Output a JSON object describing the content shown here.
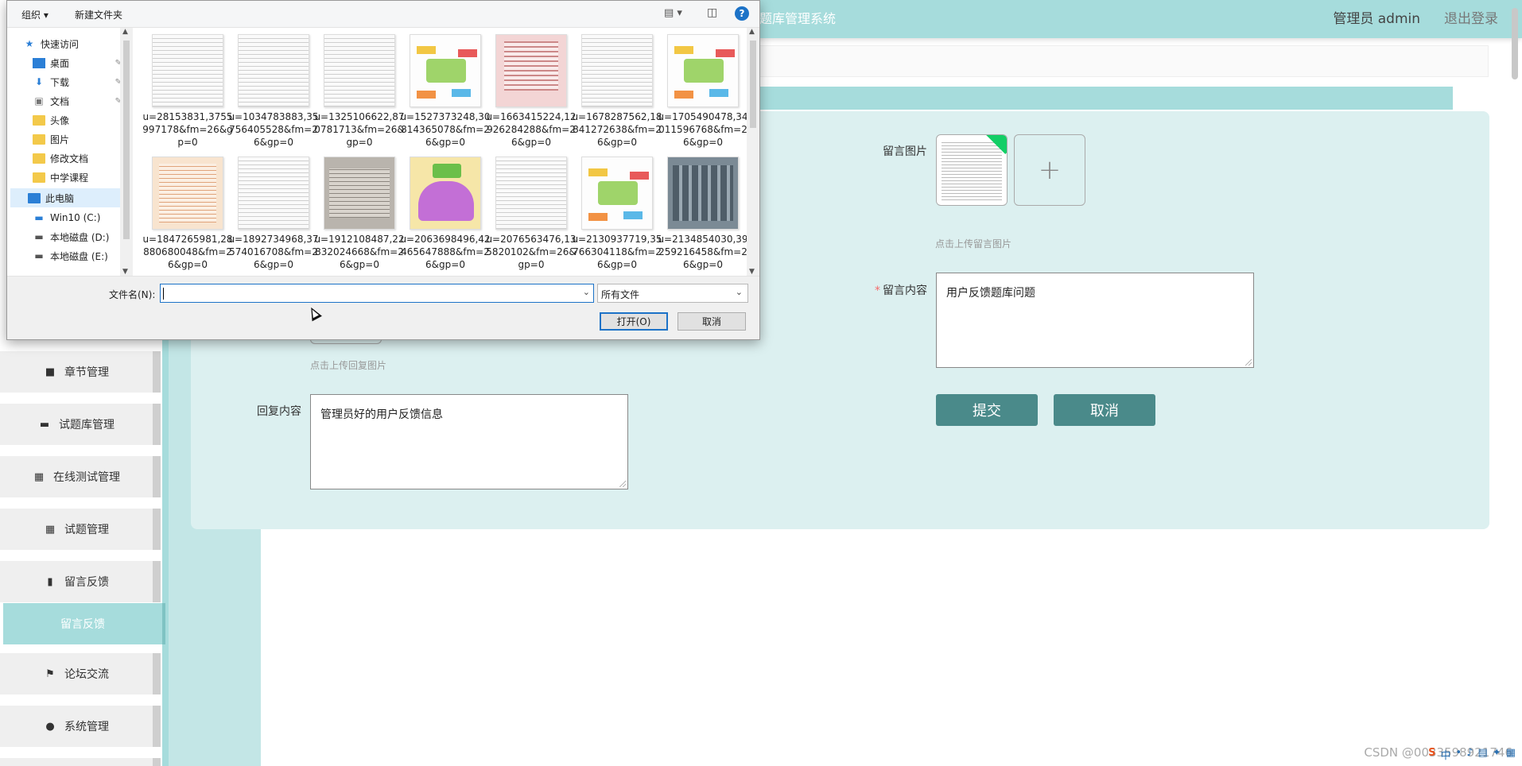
{
  "app": {
    "system_title": "题库管理系统",
    "user_label": "管理员 admin",
    "logout": "退出登录"
  },
  "sidebar": {
    "items": [
      {
        "label": "章节管理",
        "icon": "monitor-icon"
      },
      {
        "label": "试题库管理",
        "icon": "laptop-icon"
      },
      {
        "label": "在线测试管理",
        "icon": "grid-icon"
      },
      {
        "label": "试题管理",
        "icon": "grid-icon"
      },
      {
        "label": "留言反馈",
        "icon": "chart-icon"
      },
      {
        "label": "留言反馈",
        "icon": "none"
      },
      {
        "label": "论坛交流",
        "icon": "flag-icon"
      },
      {
        "label": "系统管理",
        "icon": "user-icon"
      }
    ]
  },
  "form": {
    "message_image_label": "留言图片",
    "message_image_hint": "点击上传留言图片",
    "message_content_label": "留言内容",
    "message_content_value": "用户反馈题库问题",
    "reply_image_hint": "点击上传回复图片",
    "reply_content_label": "回复内容",
    "reply_content_value": "管理员好的用户反馈信息",
    "submit": "提交",
    "cancel": "取消"
  },
  "dialog": {
    "toolbar": {
      "organize": "组织 ▾",
      "new_folder": "新建文件夹"
    },
    "nav": [
      {
        "label": "快速访问",
        "icon": "star-icon",
        "pinned": false
      },
      {
        "label": "桌面",
        "icon": "desktop-icon",
        "pinned": true
      },
      {
        "label": "下载",
        "icon": "download-icon",
        "pinned": true
      },
      {
        "label": "文档",
        "icon": "document-icon",
        "pinned": true
      },
      {
        "label": "头像",
        "icon": "folder-icon",
        "pinned": false
      },
      {
        "label": "图片",
        "icon": "folder-icon",
        "pinned": false
      },
      {
        "label": "修改文档",
        "icon": "folder-icon",
        "pinned": false
      },
      {
        "label": "中学课程",
        "icon": "folder-icon",
        "pinned": false
      },
      {
        "label": "此电脑",
        "icon": "computer-icon",
        "pinned": false
      },
      {
        "label": "Win10 (C:)",
        "icon": "drive-icon",
        "pinned": false
      },
      {
        "label": "本地磁盘 (D:)",
        "icon": "drive-icon",
        "pinned": false
      },
      {
        "label": "本地磁盘 (E:)",
        "icon": "drive-icon",
        "pinned": false
      }
    ],
    "files": [
      {
        "name": "u=28153831,3755997178&fm=26&gp=0",
        "kind": "doc"
      },
      {
        "name": "u=1034783883,35756405528&fm=26&gp=0",
        "kind": "doc"
      },
      {
        "name": "u=1325106622,870781713&fm=26&gp=0",
        "kind": "doc"
      },
      {
        "name": "u=1527373248,30814365078&fm=26&gp=0",
        "kind": "map"
      },
      {
        "name": "u=1663415224,12926284288&fm=26&gp=0",
        "kind": "red"
      },
      {
        "name": "u=1678287562,18841272638&fm=26&gp=0",
        "kind": "doc"
      },
      {
        "name": "u=1705490478,34011596768&fm=26&gp=0",
        "kind": "map"
      },
      {
        "name": "u=1847265981,28880680048&fm=26&gp=0",
        "kind": "orange"
      },
      {
        "name": "u=1892734968,37574016708&fm=26&gp=0",
        "kind": "doc"
      },
      {
        "name": "u=1912108487,22832024668&fm=26&gp=0",
        "kind": "book"
      },
      {
        "name": "u=2063698496,42465647888&fm=26&gp=0",
        "kind": "cartoon"
      },
      {
        "name": "u=2076563476,135820102&fm=26&gp=0",
        "kind": "doc"
      },
      {
        "name": "u=2130937719,35766304118&fm=26&gp=0",
        "kind": "map"
      },
      {
        "name": "u=2134854030,39259216458&fm=26&gp=0",
        "kind": "photo"
      }
    ],
    "filename_label": "文件名(N):",
    "filename_value": "",
    "filetype": "所有文件",
    "open": "打开(O)",
    "cancel": "取消"
  },
  "watermark": "CSDN @0033598921746",
  "colors": {
    "accent": "#a6dcdc",
    "button": "#4a8a8a",
    "panel": "#dcf0f0",
    "dialog_focus": "#1c72c7"
  }
}
